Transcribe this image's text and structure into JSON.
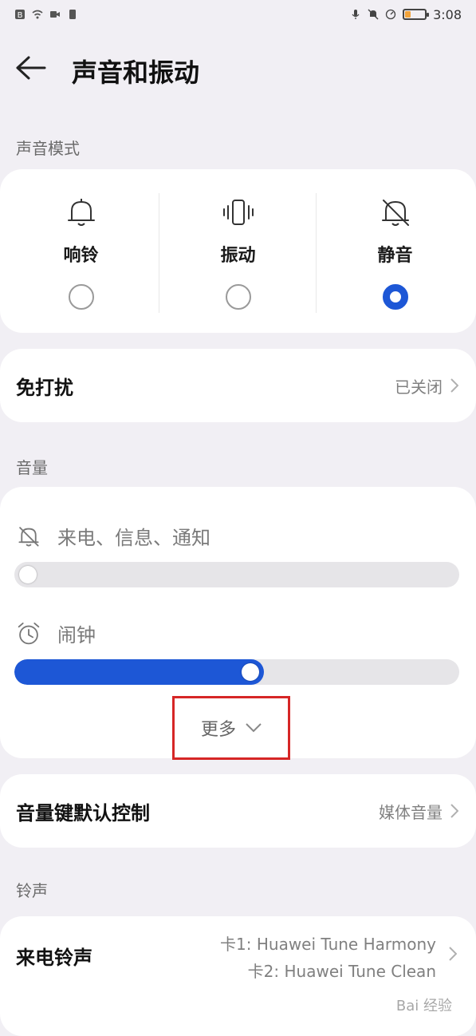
{
  "status": {
    "time": "3:08",
    "battery_color": "#f2a33a"
  },
  "header": {
    "title": "声音和振动"
  },
  "sound_mode": {
    "section_label": "声音模式",
    "modes": [
      {
        "label": "响铃",
        "icon": "bell-icon",
        "selected": false
      },
      {
        "label": "振动",
        "icon": "vibrate-icon",
        "selected": false
      },
      {
        "label": "静音",
        "icon": "bell-off-icon",
        "selected": true
      }
    ]
  },
  "dnd": {
    "label": "免打扰",
    "value": "已关闭"
  },
  "volume": {
    "section_label": "音量",
    "items": [
      {
        "label": "来电、信息、通知",
        "icon": "bell-off-icon",
        "level": 0.0
      },
      {
        "label": "闹钟",
        "icon": "alarm-icon",
        "level": 0.53
      }
    ],
    "more_label": "更多"
  },
  "volume_key": {
    "label": "音量键默认控制",
    "value": "媒体音量"
  },
  "ringtone": {
    "section_label": "铃声",
    "label": "来电铃声",
    "values": [
      "卡1: Huawei Tune Harmony",
      "卡2: Huawei Tune Clean"
    ]
  },
  "watermark": "Bai 经验",
  "accent_color": "#1d57d6"
}
